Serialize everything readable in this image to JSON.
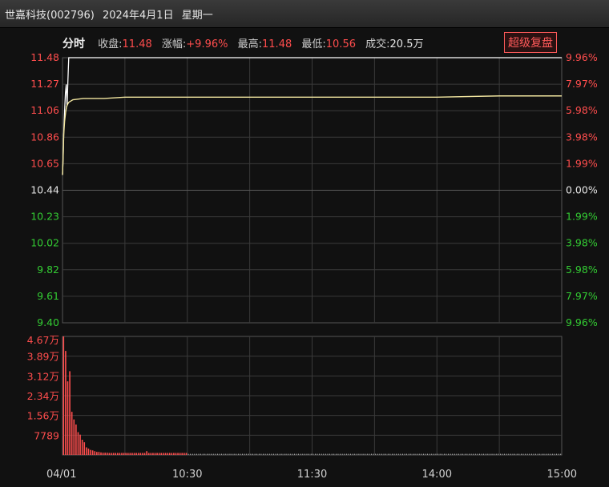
{
  "header": {
    "stock_name": "世嘉科技",
    "stock_code": "(002796)",
    "date": "2024年4月1日",
    "weekday": "星期一"
  },
  "info": {
    "mode": "分时",
    "close_label": "收盘:",
    "close_value": "11.48",
    "change_label": "涨幅:",
    "change_value": "+9.96%",
    "high_label": "最高:",
    "high_value": "11.48",
    "low_label": "最低:",
    "low_value": "10.56",
    "volume_label": "成交:",
    "volume_value": "20.5万",
    "fq_button": "超级复盘"
  },
  "colors": {
    "up": "#ff4d4d",
    "down": "#33cc33",
    "neutral": "#e6e6e6",
    "price_line": "#ffffff",
    "avg_line": "#f2e6a0",
    "grid": "#3a3a3a",
    "volume_bar": "#ff4d4d"
  },
  "chart_data": {
    "type": "line",
    "prev_close": 10.44,
    "price_axis": {
      "ylim": [
        9.4,
        11.48
      ],
      "ticks": [
        "11.48",
        "11.27",
        "11.06",
        "10.86",
        "10.65",
        "10.44",
        "10.23",
        "10.02",
        "9.82",
        "9.61",
        "9.40"
      ],
      "pct_ticks": [
        "9.96%",
        "7.97%",
        "5.98%",
        "3.98%",
        "1.99%",
        "0.00%",
        "1.99%",
        "3.98%",
        "5.98%",
        "7.97%",
        "9.96%"
      ]
    },
    "volume_axis": {
      "ylim": [
        0,
        46700
      ],
      "ticks": [
        "4.67万",
        "3.89万",
        "3.12万",
        "2.34万",
        "1.56万",
        "7789"
      ]
    },
    "time_axis": {
      "session_minutes": 240,
      "labels": [
        {
          "text": "04/01",
          "minute": 0
        },
        {
          "text": "10:30",
          "minute": 60
        },
        {
          "text": "11:30",
          "minute": 120
        },
        {
          "text": "14:00",
          "minute": 180
        },
        {
          "text": "15:00",
          "minute": 240
        }
      ]
    },
    "series": [
      {
        "key": "price",
        "points": [
          [
            0,
            10.56
          ],
          [
            0.3,
            10.7
          ],
          [
            0.6,
            10.9
          ],
          [
            1,
            11.06
          ],
          [
            1.4,
            11.2
          ],
          [
            1.8,
            11.27
          ],
          [
            2.2,
            11.1
          ],
          [
            2.6,
            11.3
          ],
          [
            3,
            11.48
          ],
          [
            3.5,
            11.48
          ],
          [
            240,
            11.48
          ]
        ]
      },
      {
        "key": "average",
        "points": [
          [
            0,
            10.56
          ],
          [
            0.3,
            10.7
          ],
          [
            0.6,
            10.88
          ],
          [
            1,
            10.98
          ],
          [
            1.5,
            11.05
          ],
          [
            2,
            11.1
          ],
          [
            3,
            11.13
          ],
          [
            5,
            11.15
          ],
          [
            10,
            11.16
          ],
          [
            20,
            11.16
          ],
          [
            30,
            11.17
          ],
          [
            60,
            11.17
          ],
          [
            120,
            11.17
          ],
          [
            180,
            11.17
          ],
          [
            210,
            11.18
          ],
          [
            240,
            11.18
          ]
        ]
      }
    ],
    "volume": [
      46700,
      41000,
      29000,
      33000,
      17000,
      14000,
      12000,
      9000,
      8000,
      6000,
      5000,
      3000,
      2500,
      2000,
      1800,
      1500,
      1200,
      1200,
      1000,
      900,
      900,
      900,
      800,
      800,
      800,
      800,
      800,
      800,
      800,
      800,
      800,
      800,
      800,
      800,
      800,
      800,
      800,
      800,
      800,
      800,
      1500,
      800,
      800,
      800,
      800,
      800,
      800,
      800,
      800,
      800,
      800,
      800,
      800,
      800,
      800,
      800,
      800,
      800,
      800,
      800
    ]
  }
}
